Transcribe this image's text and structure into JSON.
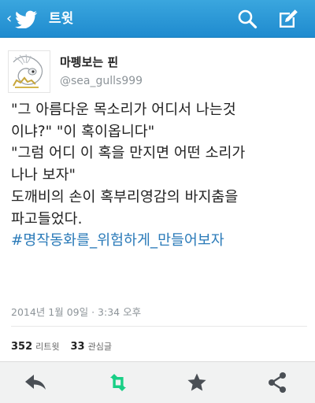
{
  "header": {
    "back_glyph": "‹",
    "title": "트윗",
    "back_icon": "twitter-bird-icon",
    "search_icon": "search-icon",
    "compose_icon": "compose-icon",
    "bar_color": "#2a98d8"
  },
  "tweet": {
    "display_name": "마펭보는 핀",
    "handle": "@sea_gulls999",
    "lines": [
      "\"그 아름다운 목소리가 어디서 나는것",
      "이냐?\" \"이 혹이옵니다\"",
      "\"그럼 어디 이 혹을 만지면 어떤 소리가",
      "나나 보자\"",
      "도깨비의 손이 혹부리영감의 바지춤을",
      "파고들었다."
    ],
    "hashtag": "#명작동화를_위험하게_만들어보자",
    "timestamp": "2014년 1월 09일 · 3:34 오후",
    "link_color": "#2b7bb9"
  },
  "stats": {
    "retweets_count": "352",
    "retweets_label": "리트윗",
    "favorites_count": "33",
    "favorites_label": "관심글"
  },
  "actions": {
    "reply_icon": "reply-icon",
    "retweet_icon": "retweet-icon",
    "favorite_icon": "star-icon",
    "share_icon": "share-icon",
    "retweet_color": "#19cf86"
  }
}
